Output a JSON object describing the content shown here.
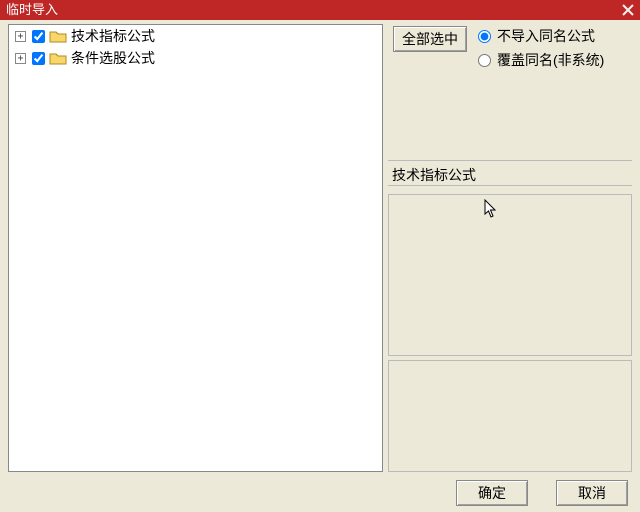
{
  "title": "临时导入",
  "tree": {
    "items": [
      {
        "label": "技术指标公式",
        "checked": true
      },
      {
        "label": "条件选股公式",
        "checked": true
      }
    ]
  },
  "buttons": {
    "select_all": "全部选中",
    "ok": "确定",
    "cancel": "取消"
  },
  "radio": {
    "skip_same": "不导入同名公式",
    "overwrite": "覆盖同名(非系统)",
    "selected": "skip_same"
  },
  "info_label": "技术指标公式",
  "preview1_text": "",
  "preview2_text": ""
}
